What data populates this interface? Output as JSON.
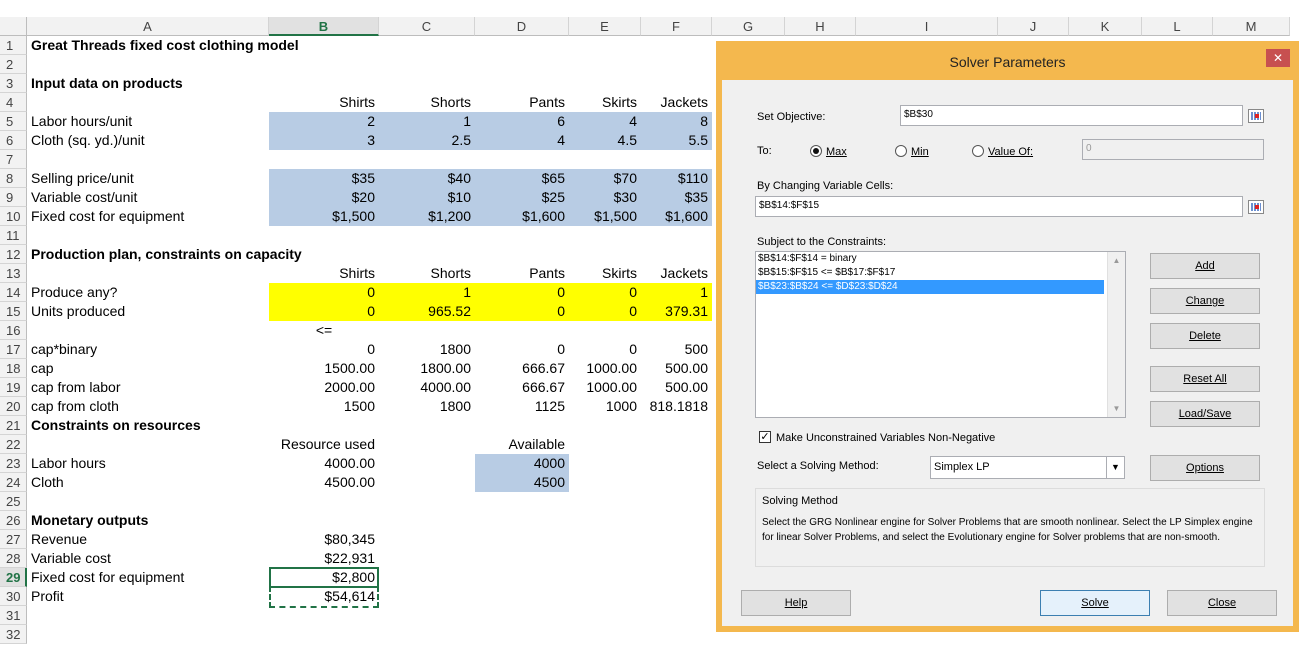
{
  "columns": [
    "A",
    "B",
    "C",
    "D",
    "E",
    "F",
    "G",
    "H",
    "I",
    "J",
    "K",
    "L",
    "M"
  ],
  "selected_column": "B",
  "rows": [
    "1",
    "2",
    "3",
    "4",
    "5",
    "6",
    "7",
    "8",
    "9",
    "10",
    "11",
    "12",
    "13",
    "14",
    "15",
    "16",
    "17",
    "18",
    "19",
    "20",
    "21",
    "22",
    "23",
    "24",
    "25",
    "26",
    "27",
    "28",
    "29",
    "30",
    "31",
    "32"
  ],
  "selected_row": "29",
  "colors": {
    "blue_input": "#b8cce4",
    "yellow_input": "#ffff00",
    "excel_green": "#217346",
    "dialog_border": "#f4b84e"
  },
  "cells": {
    "A1": "Great Threads fixed cost clothing model",
    "A3": "Input data on products",
    "B4": "Shirts",
    "C4": "Shorts",
    "D4": "Pants",
    "E4": "Skirts",
    "F4": "Jackets",
    "A5": "Labor hours/unit",
    "B5": "2",
    "C5": "1",
    "D5": "6",
    "E5": "4",
    "F5": "8",
    "A6": "Cloth (sq. yd.)/unit",
    "B6": "3",
    "C6": "2.5",
    "D6": "4",
    "E6": "4.5",
    "F6": "5.5",
    "A8": "Selling price/unit",
    "B8": "$35",
    "C8": "$40",
    "D8": "$65",
    "E8": "$70",
    "F8": "$110",
    "A9": "Variable cost/unit",
    "B9": "$20",
    "C9": "$10",
    "D9": "$25",
    "E9": "$30",
    "F9": "$35",
    "A10": "Fixed cost for equipment",
    "B10": "$1,500",
    "C10": "$1,200",
    "D10": "$1,600",
    "E10": "$1,500",
    "F10": "$1,600",
    "A12": "Production plan, constraints on capacity",
    "B13": "Shirts",
    "C13": "Shorts",
    "D13": "Pants",
    "E13": "Skirts",
    "F13": "Jackets",
    "A14": "Produce any?",
    "B14": "0",
    "C14": "1",
    "D14": "0",
    "E14": "0",
    "F14": "1",
    "A15": "Units produced",
    "B15": "0",
    "C15": "965.52",
    "D15": "0",
    "E15": "0",
    "F15": "379.31",
    "B16": "<=",
    "A17": "cap*binary",
    "B17": "0",
    "C17": "1800",
    "D17": "0",
    "E17": "0",
    "F17": "500",
    "A18": "cap",
    "B18": "1500.00",
    "C18": "1800.00",
    "D18": "666.67",
    "E18": "1000.00",
    "F18": "500.00",
    "A19": "cap from labor",
    "B19": "2000.00",
    "C19": "4000.00",
    "D19": "666.67",
    "E19": "1000.00",
    "F19": "500.00",
    "A20": "cap from cloth",
    "B20": "1500",
    "C20": "1800",
    "D20": "1125",
    "E20": "1000",
    "F20": "818.1818",
    "A21": "Constraints on resources",
    "B22": "Resource used",
    "D22": "Available",
    "A23": "Labor hours",
    "B23": "4000.00",
    "D23": "4000",
    "A24": "Cloth",
    "B24": "4500.00",
    "D24": "4500",
    "A26": "Monetary outputs",
    "A27": "Revenue",
    "B27": "$80,345",
    "A28": "Variable cost",
    "B28": "$22,931",
    "A29": "Fixed cost for equipment",
    "B29": "$2,800",
    "A30": "Profit",
    "B30": "$54,614"
  },
  "dialog": {
    "title": "Solver Parameters",
    "close_glyph": "✕",
    "set_objective_label": "Set Objective:",
    "set_objective_value": "$B$30",
    "to_label": "To:",
    "max_label": "Max",
    "min_label": "Min",
    "value_of_label": "Value Of:",
    "value_of_value": "0",
    "selected_goal": "Max",
    "changing_cells_label": "By Changing Variable Cells:",
    "changing_cells_value": "$B$14:$F$15",
    "constraints_label": "Subject to the Constraints:",
    "constraints": [
      "$B$14:$F$14 = binary",
      "$B$15:$F$15 <= $B$17:$F$17",
      "$B$23:$B$24 <= $D$23:$D$24"
    ],
    "selected_constraint_index": 2,
    "add_button": "Add",
    "change_button": "Change",
    "delete_button": "Delete",
    "reset_all_button": "Reset All",
    "load_save_button": "Load/Save",
    "nonneg_label": "Make Unconstrained Variables Non-Negative",
    "nonneg_checked": true,
    "check_glyph": "✓",
    "solving_method_label": "Select a Solving Method:",
    "solving_method_value": "Simplex LP",
    "options_button": "Options",
    "method_box_title": "Solving Method",
    "method_box_text": "Select the GRG Nonlinear engine for Solver Problems that are smooth nonlinear. Select the LP Simplex engine for linear Solver Problems, and select the Evolutionary engine for Solver problems that are non-smooth.",
    "help_button": "Help",
    "solve_button": "Solve",
    "close_button": "Close"
  }
}
